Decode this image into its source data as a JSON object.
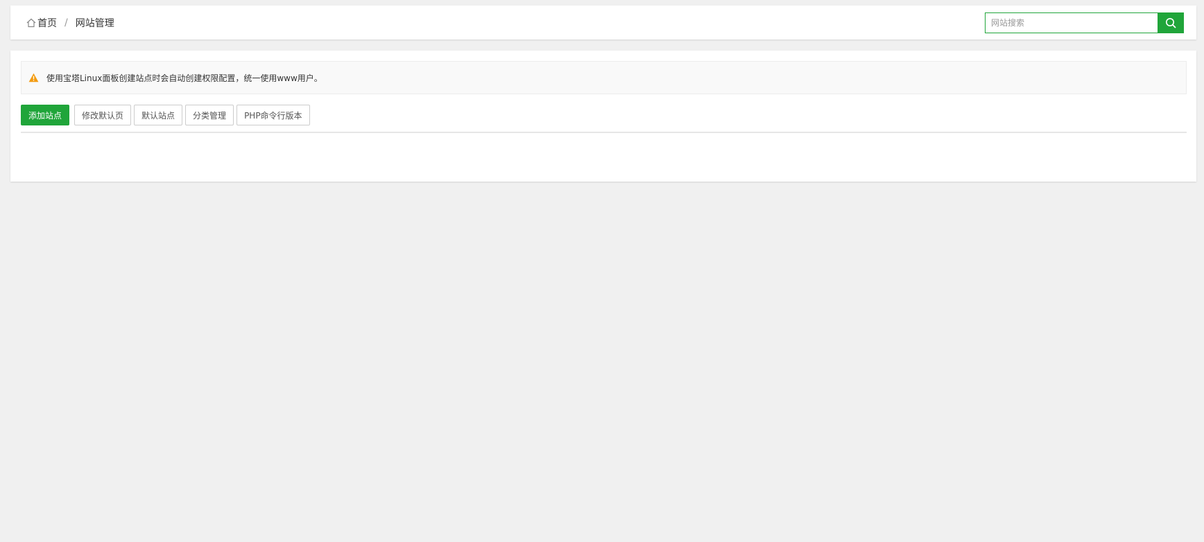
{
  "breadcrumb": {
    "home_label": "首页",
    "separator": "/",
    "current": "网站管理"
  },
  "search": {
    "placeholder": "网站搜索",
    "value": ""
  },
  "notice": {
    "text": "使用宝塔Linux面板创建站点时会自动创建权限配置，统一使用www用户。"
  },
  "toolbar": {
    "add_site": "添加站点",
    "edit_default_page": "修改默认页",
    "default_site": "默认站点",
    "category_manage": "分类管理",
    "php_cli_version": "PHP命令行版本"
  },
  "colors": {
    "accent": "#20a53a",
    "warning": "#f39c12",
    "background": "#f0f0f0"
  },
  "icons": {
    "home": "home-icon",
    "search": "search-icon",
    "warning": "warning-icon"
  }
}
